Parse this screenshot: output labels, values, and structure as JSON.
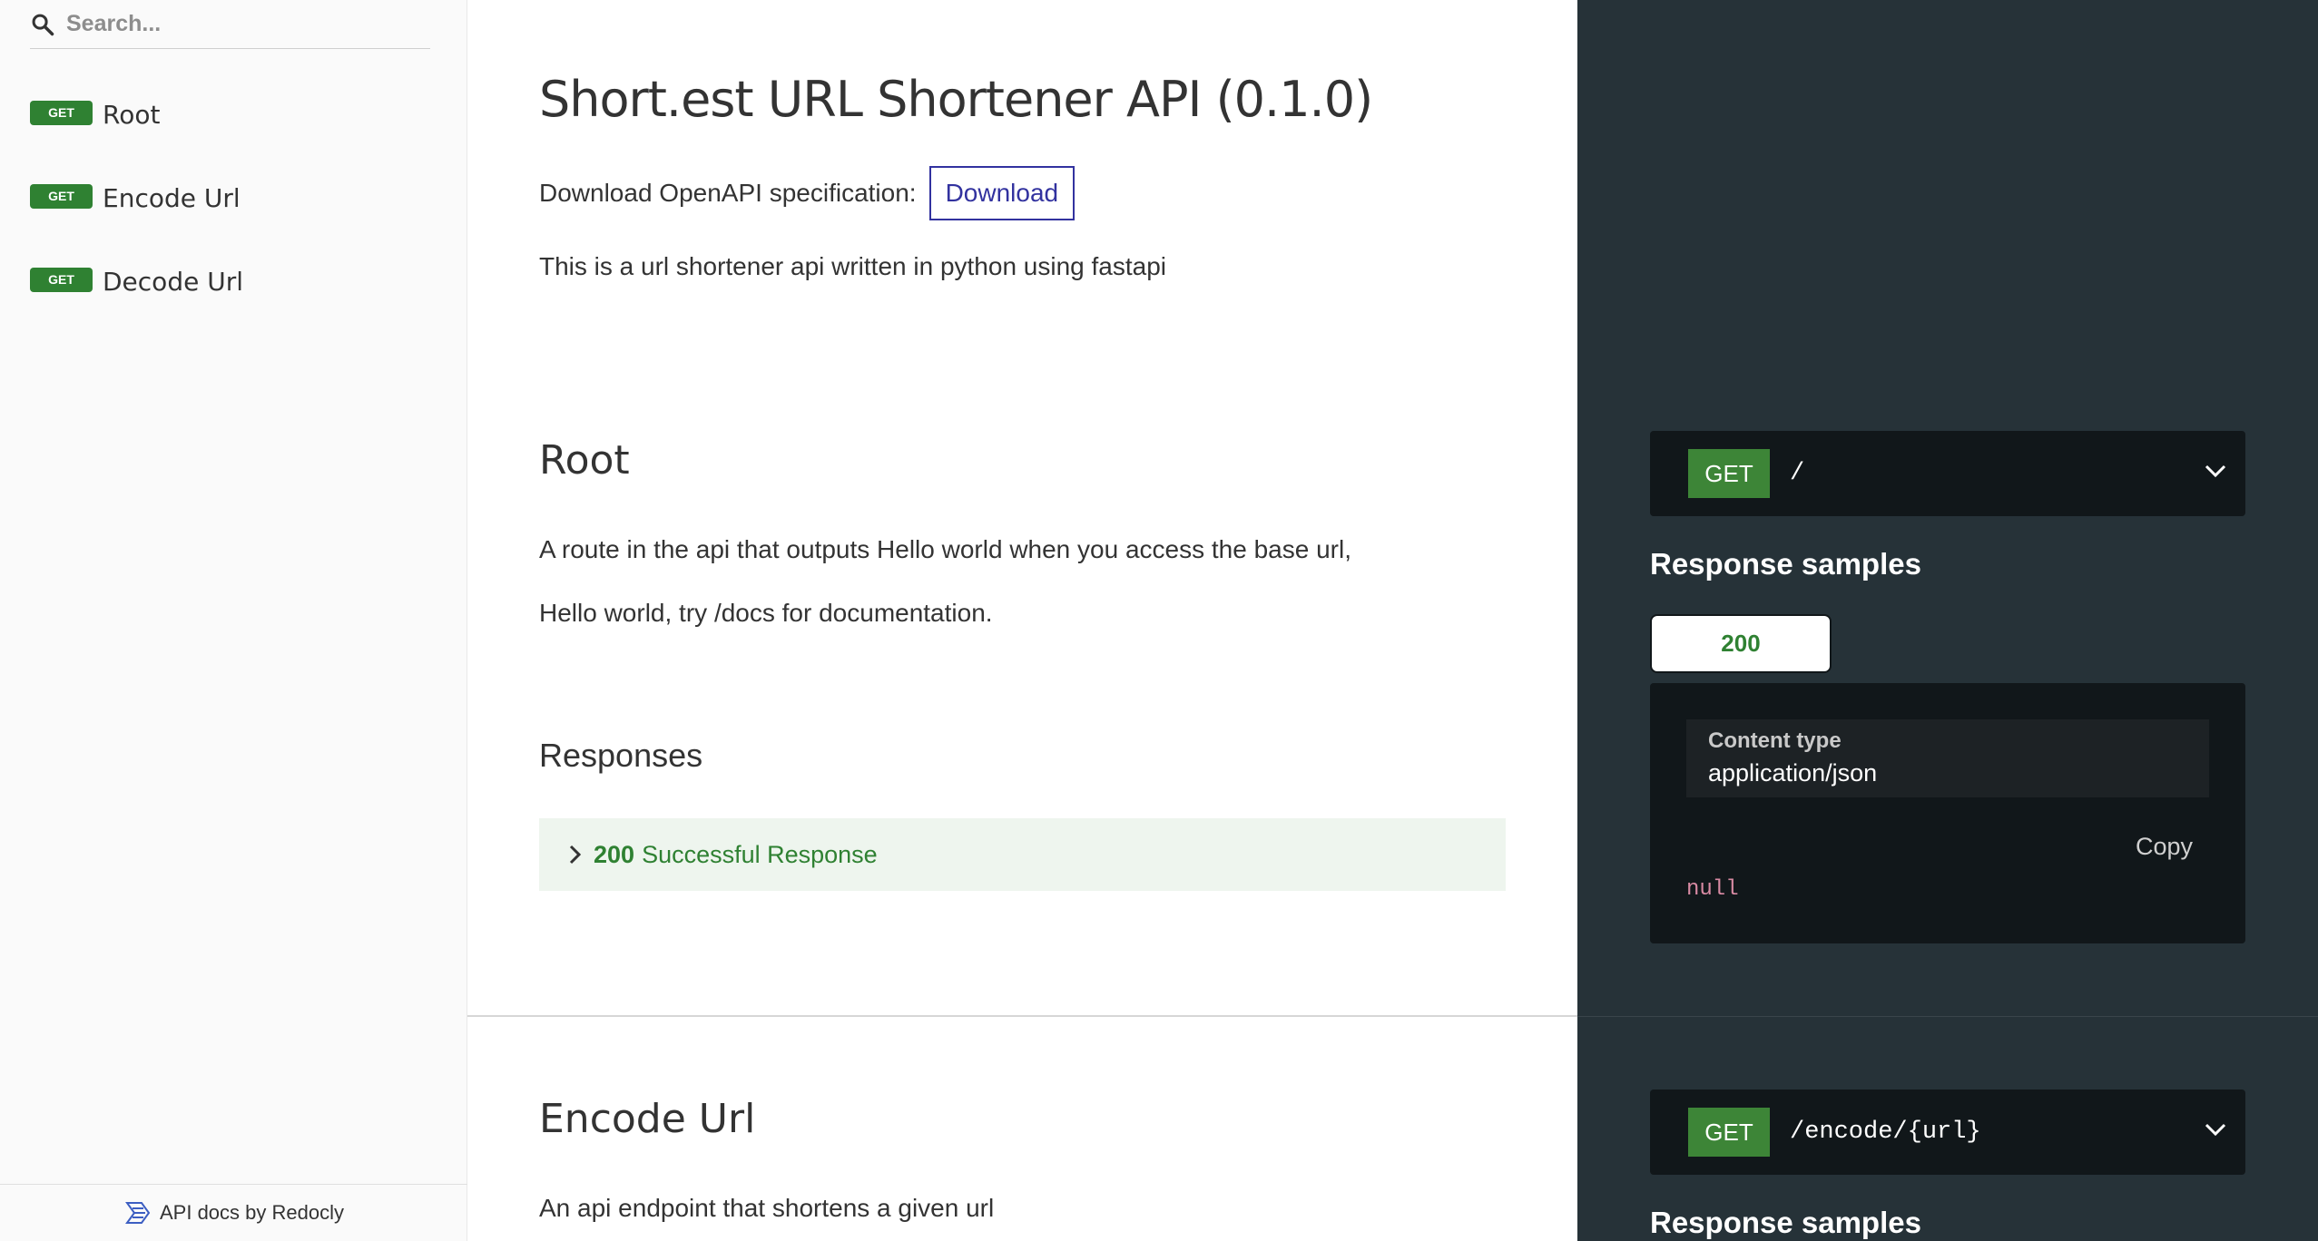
{
  "sidebar": {
    "search_placeholder": "Search...",
    "items": [
      {
        "method": "GET",
        "label": "Root"
      },
      {
        "method": "GET",
        "label": "Encode Url"
      },
      {
        "method": "GET",
        "label": "Decode Url"
      }
    ],
    "footer": "API docs by Redocly"
  },
  "main": {
    "title": "Short.est URL Shortener API (0.1.0)",
    "download_label": "Download OpenAPI specification:",
    "download_button": "Download",
    "description": "This is a url shortener api written in python using fastapi",
    "root": {
      "heading": "Root",
      "desc1": "A route in the api that outputs Hello world when you access the base url,",
      "desc2": "Hello world, try /docs for documentation.",
      "responses_heading": "Responses",
      "response_code": "200",
      "response_text": "Successful Response"
    },
    "encode": {
      "heading": "Encode Url",
      "desc": "An api endpoint that shortens a given url"
    }
  },
  "right_panel": {
    "root_endpoint": {
      "method": "GET",
      "path": "/"
    },
    "response_samples_title": "Response samples",
    "tab": "200",
    "content_type_label": "Content type",
    "content_type_value": "application/json",
    "copy_label": "Copy",
    "sample_value": "null",
    "encode_endpoint": {
      "method": "GET",
      "path": "/encode/{url}"
    },
    "encode_response_samples_title": "Response samples"
  },
  "colors": {
    "get_badge": "#2f8132",
    "link": "#32329f",
    "right_bg": "#263238",
    "code_bg": "#11171a"
  }
}
